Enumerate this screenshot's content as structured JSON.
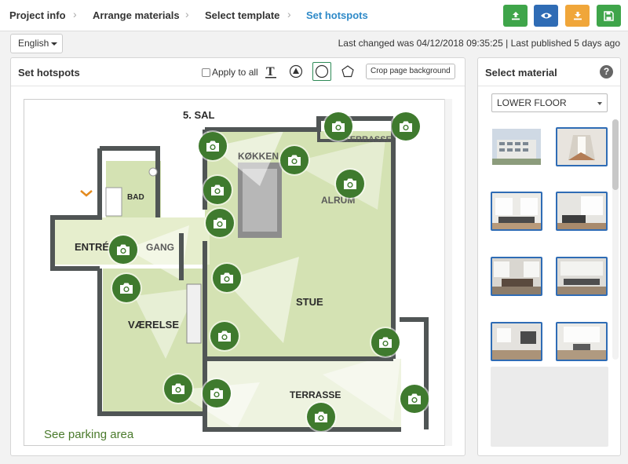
{
  "nav": {
    "breadcrumbs": [
      "Project info",
      "Arrange materials",
      "Select template",
      "Set hotspots"
    ],
    "active": "Set hotspots",
    "actions": [
      {
        "name": "upload",
        "icon": "upload-icon",
        "color": "#3fa54a"
      },
      {
        "name": "preview",
        "icon": "eye-icon",
        "color": "#2f6cb5"
      },
      {
        "name": "download",
        "icon": "download-icon",
        "color": "#f0a63a"
      },
      {
        "name": "save",
        "icon": "save-icon",
        "color": "#3fa54a"
      }
    ]
  },
  "language": {
    "selected": "English"
  },
  "status_text": "Last changed was 04/12/2018 09:35:25 | Last published 5 days ago",
  "hotspots_panel": {
    "title": "Set hotspots",
    "apply_all_label": "Apply to all",
    "apply_all_checked": false,
    "tools": [
      "text-tool-icon",
      "triangle-circle-tool-icon",
      "circle-tool-icon",
      "pentagon-tool-icon"
    ],
    "selected_tool": "circle-tool-icon",
    "crop_button": "Crop page background",
    "floorplan_labels": {
      "floor": "5. SAL",
      "kitchen": "KØKKEN",
      "terrace_top": "TERRASSE",
      "alrum": "ALRUM",
      "bad": "BAD",
      "entre": "ENTRÉ",
      "gang": "GANG",
      "vaerelse": "VÆRELSE",
      "stue": "STUE",
      "terrace_bottom": "TERRASSE"
    },
    "parking_link": "See parking area",
    "accent_color": "#3f7a2e",
    "hotspot_count": 19
  },
  "material_panel": {
    "title": "Select material",
    "help_icon": "?",
    "dropdown": "LOWER FLOOR",
    "thumbnails": [
      {
        "label": "exterior",
        "selected": false
      },
      {
        "label": "hallway",
        "selected": true
      },
      {
        "label": "living-room-1",
        "selected": true
      },
      {
        "label": "living-room-2",
        "selected": true
      },
      {
        "label": "kitchen-1",
        "selected": true
      },
      {
        "label": "kitchen-2",
        "selected": true
      },
      {
        "label": "room-1",
        "selected": true
      },
      {
        "label": "room-2",
        "selected": true
      }
    ]
  }
}
